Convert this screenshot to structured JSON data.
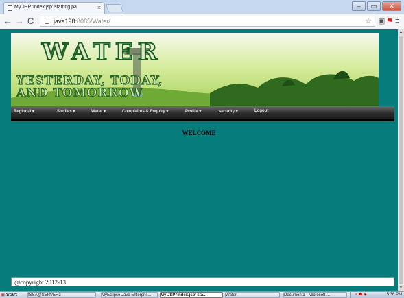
{
  "browser": {
    "tab": {
      "title": "My JSP 'index.jsp' starting pa",
      "close": "×"
    },
    "window_buttons": {
      "minimize": "–",
      "maximize": "▭",
      "close": "✕"
    },
    "nav": {
      "back": "←",
      "forward": "→",
      "reload": "C"
    },
    "address": {
      "host": "java198",
      "path": ":8085/Water/"
    },
    "icons": {
      "star": "star-icon",
      "extension": "extension-icon",
      "flag": "flag-icon",
      "menu": "wrench-menu-icon"
    }
  },
  "banner": {
    "title": "WATER",
    "subtitle_line1": "YESTERDAY, TODAY,",
    "subtitle_line2": "AND TOMORROW"
  },
  "menu": {
    "items": [
      {
        "label": "Regional",
        "dropdown": "▾"
      },
      {
        "label": "Studies",
        "dropdown": "▾"
      },
      {
        "label": "Water",
        "dropdown": "▾"
      },
      {
        "label": "Complaints & Enquiry",
        "dropdown": "▾"
      },
      {
        "label": "Profile",
        "dropdown": "▾"
      },
      {
        "label": "security",
        "dropdown": "▾"
      },
      {
        "label": "Logout",
        "dropdown": ""
      }
    ]
  },
  "content": {
    "heading": "WELCOME"
  },
  "footer": {
    "text": "@copyright 2012-13"
  },
  "taskbar": {
    "start": "Start",
    "tasks": [
      {
        "label": "ISSA@SERVER3"
      },
      {
        "label": "MyEclipse Java Enterpris..."
      },
      {
        "label": "My JSP 'index.jsp' sta...",
        "active": true
      },
      {
        "label": "Water"
      },
      {
        "label": "Document1 - Microsoft ..."
      }
    ],
    "tray_icons": "« ☗ ◈",
    "clock": "5:36 PM"
  },
  "colors": {
    "page_background": "#077c7c",
    "nav_background": "#2b2b2b",
    "banner_green": "#a9d35c"
  }
}
